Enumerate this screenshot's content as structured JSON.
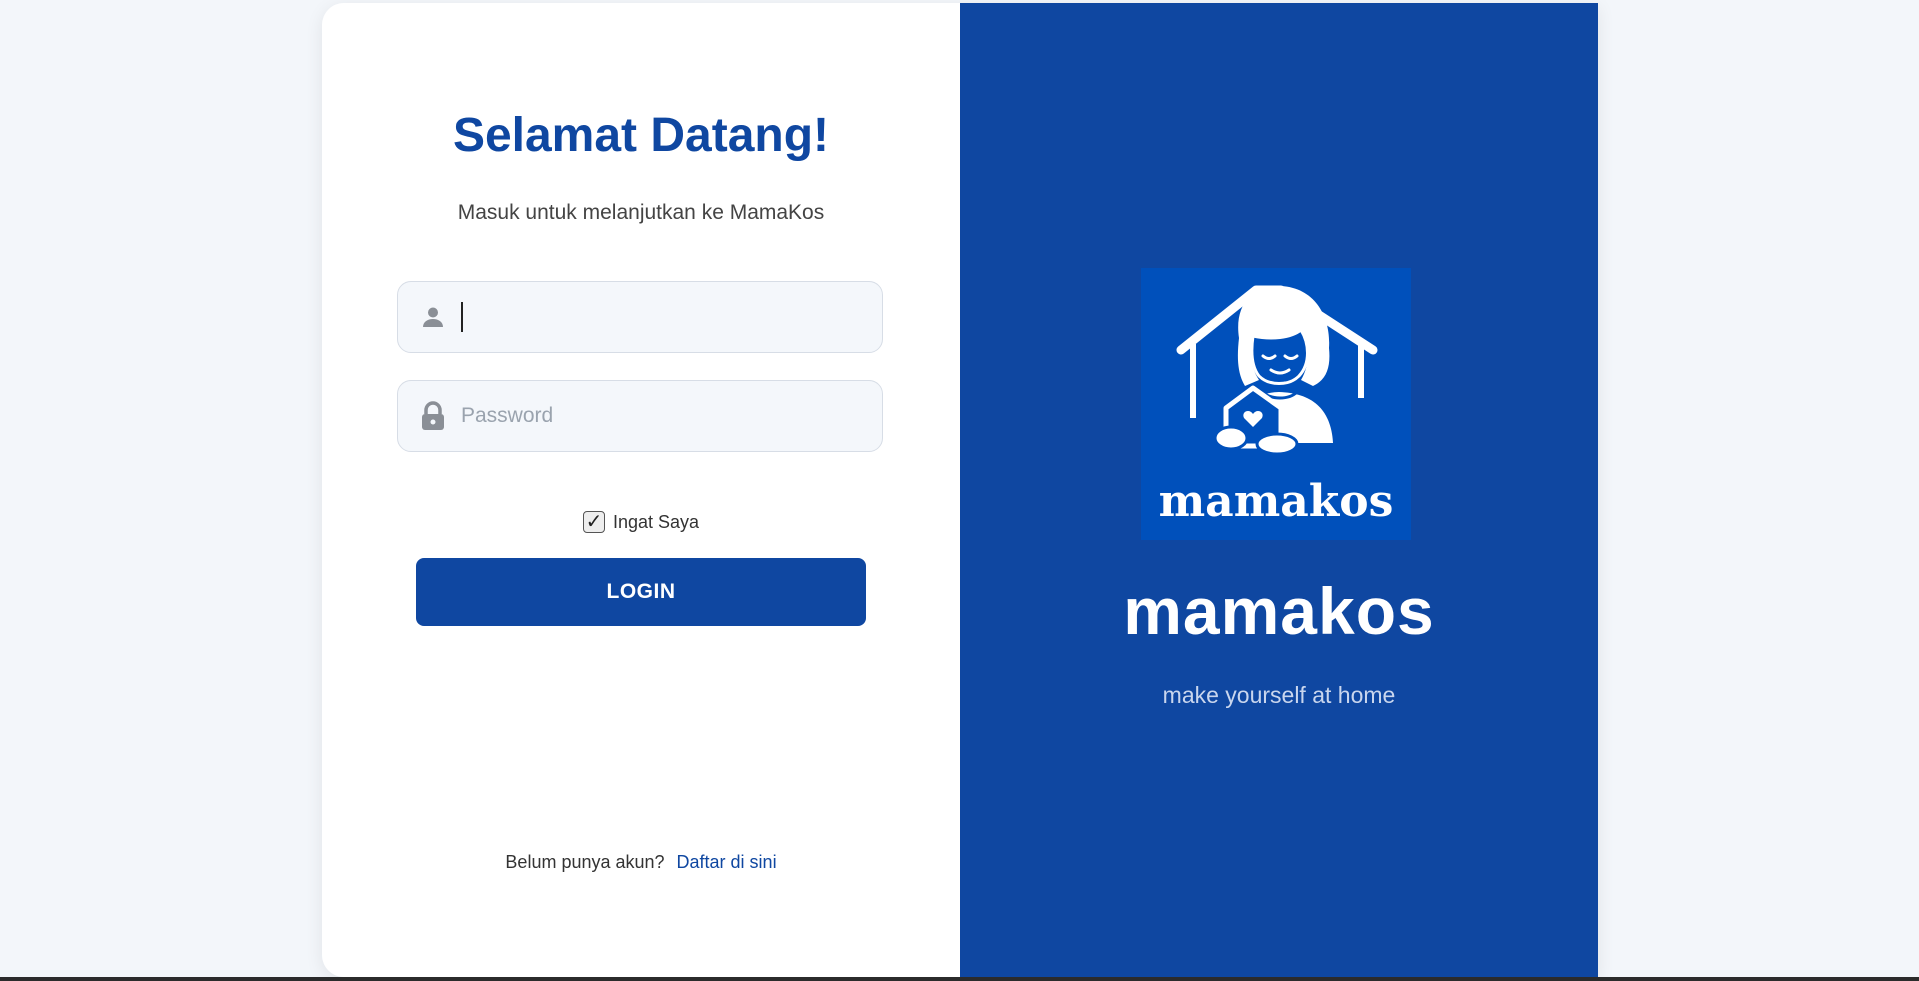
{
  "login": {
    "title": "Selamat Datang!",
    "subtitle": "Masuk untuk melanjutkan ke MamaKos",
    "username": {
      "value": "",
      "placeholder": "",
      "icon": "user-icon"
    },
    "password": {
      "value": "",
      "placeholder": "Password",
      "icon": "lock-icon"
    },
    "remember": {
      "label": "Ingat Saya",
      "checked": true
    },
    "button_label": "LOGIN",
    "register_prompt": "Belum punya akun?",
    "register_link": "Daftar di sini"
  },
  "brand": {
    "logo_text": "mamakos",
    "name": "mamakos",
    "tagline": "make yourself at home"
  },
  "colors": {
    "primary": "#0f47a1",
    "logo_bg": "#0050bb",
    "page_bg": "#f3f6fa",
    "field_bg": "#f4f7fb"
  }
}
